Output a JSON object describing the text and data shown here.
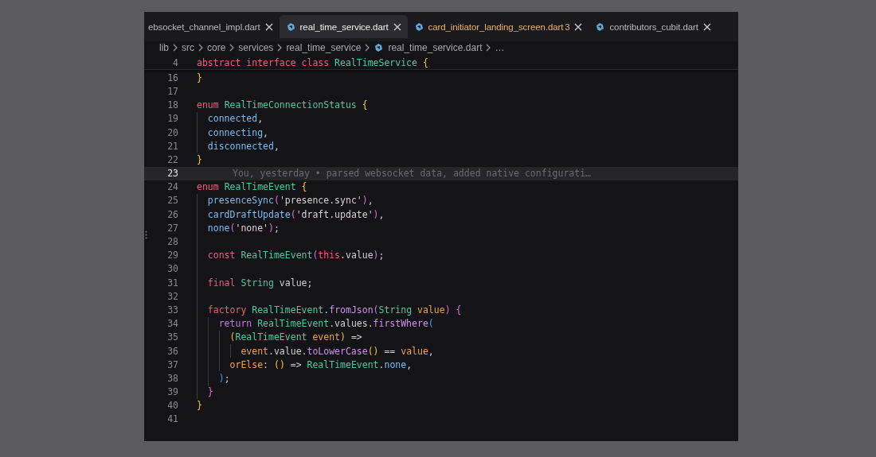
{
  "tabs": [
    {
      "label": "ebsocket_channel_impl.dart",
      "selected": false,
      "has_icon": false,
      "warning": false
    },
    {
      "label": "real_time_service.dart",
      "selected": true,
      "has_icon": true,
      "warning": false
    },
    {
      "label": "card_initiator_landing_screen.dart",
      "selected": false,
      "has_icon": true,
      "warning": true,
      "problems": "3"
    },
    {
      "label": "contributors_cubit.dart",
      "selected": false,
      "has_icon": true,
      "warning": false
    }
  ],
  "breadcrumb": [
    {
      "label": "lib",
      "has_icon": false
    },
    {
      "label": "src",
      "has_icon": false
    },
    {
      "label": "core",
      "has_icon": false
    },
    {
      "label": "services",
      "has_icon": false
    },
    {
      "label": "real_time_service",
      "has_icon": false
    },
    {
      "label": "real_time_service.dart",
      "has_icon": true
    },
    {
      "label": "…",
      "has_icon": false
    }
  ],
  "editor": {
    "sticky_line": {
      "number": "4",
      "tokens": [
        {
          "text": "abstract interface class ",
          "kind": "keyword"
        },
        {
          "text": "RealTimeService",
          "kind": "type"
        },
        {
          "text": " {",
          "kind": "bracket1"
        }
      ]
    },
    "lines": [
      {
        "number": "16",
        "current": false,
        "tokens": [
          {
            "text": "}",
            "kind": "bracket1"
          }
        ]
      },
      {
        "number": "17",
        "current": false
      },
      {
        "number": "18",
        "current": false,
        "tokens": [
          {
            "text": "enum ",
            "kind": "keyword"
          },
          {
            "text": "RealTimeConnectionStatus",
            "kind": "type"
          },
          {
            "text": " {",
            "kind": "bracket1"
          }
        ]
      },
      {
        "number": "19",
        "current": false,
        "tokens": [
          {
            "text": "  connected",
            "kind": "member"
          },
          {
            "text": ",",
            "kind": "plain"
          }
        ]
      },
      {
        "number": "20",
        "current": false,
        "tokens": [
          {
            "text": "  connecting",
            "kind": "member"
          },
          {
            "text": ",",
            "kind": "plain"
          }
        ]
      },
      {
        "number": "21",
        "current": false,
        "tokens": [
          {
            "text": "  disconnected",
            "kind": "member"
          },
          {
            "text": ",",
            "kind": "plain"
          }
        ]
      },
      {
        "number": "22",
        "current": false,
        "tokens": [
          {
            "text": "}",
            "kind": "bracket1"
          }
        ]
      },
      {
        "number": "23",
        "current": true,
        "blame": "You, yesterday • parsed websocket data, added native configurati…"
      },
      {
        "number": "24",
        "current": false,
        "tokens": [
          {
            "text": "enum ",
            "kind": "keyword"
          },
          {
            "text": "RealTimeEvent",
            "kind": "type"
          },
          {
            "text": " {",
            "kind": "bracket1"
          }
        ]
      },
      {
        "number": "25",
        "current": false,
        "tokens": [
          {
            "text": "  presenceSync",
            "kind": "member"
          },
          {
            "text": "(",
            "kind": "bracket2"
          },
          {
            "text": "'presence.sync'",
            "kind": "string"
          },
          {
            "text": ")",
            "kind": "bracket2"
          },
          {
            "text": ",",
            "kind": "plain"
          }
        ]
      },
      {
        "number": "26",
        "current": false,
        "tokens": [
          {
            "text": "  cardDraftUpdate",
            "kind": "member"
          },
          {
            "text": "(",
            "kind": "bracket2"
          },
          {
            "text": "'draft.update'",
            "kind": "string"
          },
          {
            "text": ")",
            "kind": "bracket2"
          },
          {
            "text": ",",
            "kind": "plain"
          }
        ]
      },
      {
        "number": "27",
        "current": false,
        "tokens": [
          {
            "text": "  none",
            "kind": "member"
          },
          {
            "text": "(",
            "kind": "bracket2"
          },
          {
            "text": "'none'",
            "kind": "string"
          },
          {
            "text": ")",
            "kind": "bracket2"
          },
          {
            "text": ";",
            "kind": "plain"
          }
        ]
      },
      {
        "number": "28",
        "current": false
      },
      {
        "number": "29",
        "current": false,
        "tokens": [
          {
            "text": "  const ",
            "kind": "keyword"
          },
          {
            "text": "RealTimeEvent",
            "kind": "type"
          },
          {
            "text": "(",
            "kind": "bracket2"
          },
          {
            "text": "this",
            "kind": "keyword"
          },
          {
            "text": ".value",
            "kind": "plain"
          },
          {
            "text": ")",
            "kind": "bracket2"
          },
          {
            "text": ";",
            "kind": "plain"
          }
        ]
      },
      {
        "number": "30",
        "current": false
      },
      {
        "number": "31",
        "current": false,
        "tokens": [
          {
            "text": "  final ",
            "kind": "keyword"
          },
          {
            "text": "String",
            "kind": "type"
          },
          {
            "text": " value;",
            "kind": "plain"
          }
        ]
      },
      {
        "number": "32",
        "current": false
      },
      {
        "number": "33",
        "current": false,
        "tokens": [
          {
            "text": "  factory ",
            "kind": "keyword"
          },
          {
            "text": "RealTimeEvent",
            "kind": "type"
          },
          {
            "text": ".",
            "kind": "plain"
          },
          {
            "text": "fromJson",
            "kind": "function"
          },
          {
            "text": "(",
            "kind": "bracket2"
          },
          {
            "text": "String ",
            "kind": "type"
          },
          {
            "text": "value",
            "kind": "parameter"
          },
          {
            "text": ")",
            "kind": "bracket2"
          },
          {
            "text": " {",
            "kind": "bracket2"
          }
        ]
      },
      {
        "number": "34",
        "current": false,
        "tokens": [
          {
            "text": "    return ",
            "kind": "control"
          },
          {
            "text": "RealTimeEvent",
            "kind": "type"
          },
          {
            "text": ".values.",
            "kind": "plain"
          },
          {
            "text": "firstWhere",
            "kind": "function"
          },
          {
            "text": "(",
            "kind": "bracket3"
          }
        ]
      },
      {
        "number": "35",
        "current": false,
        "tokens": [
          {
            "text": "      (",
            "kind": "bracket1"
          },
          {
            "text": "RealTimeEvent ",
            "kind": "type"
          },
          {
            "text": "event",
            "kind": "parameter"
          },
          {
            "text": ")",
            "kind": "bracket1"
          },
          {
            "text": " =>",
            "kind": "plain"
          }
        ]
      },
      {
        "number": "36",
        "current": false,
        "tokens": [
          {
            "text": "        event",
            "kind": "parameter"
          },
          {
            "text": ".value.",
            "kind": "plain"
          },
          {
            "text": "toLowerCase",
            "kind": "function"
          },
          {
            "text": "()",
            "kind": "bracket1"
          },
          {
            "text": " == ",
            "kind": "plain"
          },
          {
            "text": "value",
            "kind": "parameter"
          },
          {
            "text": ",",
            "kind": "plain"
          }
        ]
      },
      {
        "number": "37",
        "current": false,
        "tokens": [
          {
            "text": "      orElse",
            "kind": "parameter"
          },
          {
            "text": ": ",
            "kind": "plain"
          },
          {
            "text": "()",
            "kind": "bracket1"
          },
          {
            "text": " => ",
            "kind": "plain"
          },
          {
            "text": "RealTimeEvent",
            "kind": "type"
          },
          {
            "text": ".",
            "kind": "plain"
          },
          {
            "text": "none",
            "kind": "member"
          },
          {
            "text": ",",
            "kind": "plain"
          }
        ]
      },
      {
        "number": "38",
        "current": false,
        "tokens": [
          {
            "text": "    )",
            "kind": "bracket3"
          },
          {
            "text": ";",
            "kind": "plain"
          }
        ]
      },
      {
        "number": "39",
        "current": false,
        "tokens": [
          {
            "text": "  }",
            "kind": "bracket2"
          }
        ]
      },
      {
        "number": "40",
        "current": false,
        "tokens": [
          {
            "text": "}",
            "kind": "bracket1"
          }
        ]
      },
      {
        "number": "41",
        "current": false
      }
    ]
  }
}
